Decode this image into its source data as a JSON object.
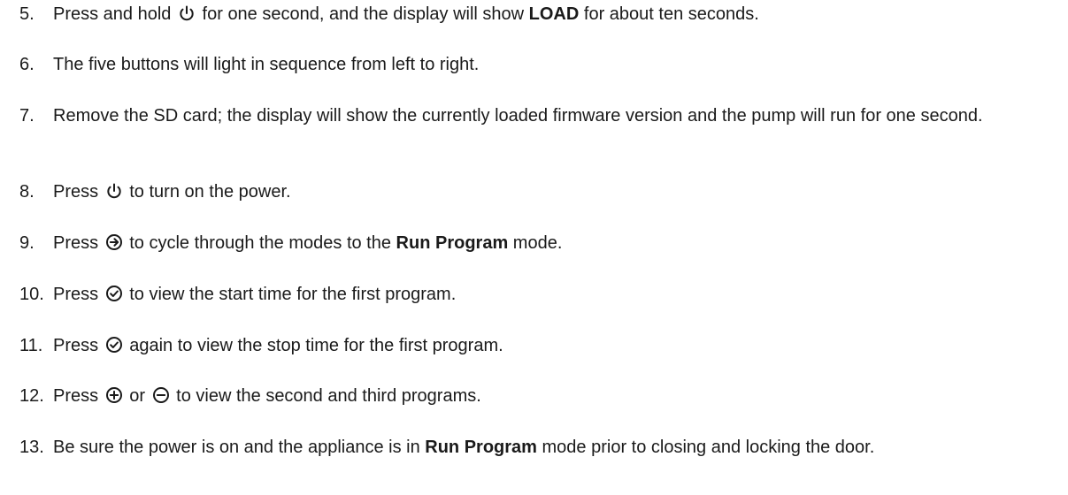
{
  "steps": [
    {
      "number": "5.",
      "parts": [
        {
          "t": "Press and hold "
        },
        {
          "icon": "power-icon"
        },
        {
          "t": " for one second, and the display will show "
        },
        {
          "t": "LOAD",
          "bold": true
        },
        {
          "t": " for about ten seconds."
        }
      ]
    },
    {
      "number": "6.",
      "parts": [
        {
          "t": "The five buttons will light in sequence from left to right."
        }
      ]
    },
    {
      "number": "7.",
      "parts": [
        {
          "t": "Remove the SD card; the display will show the currently loaded firmware version and the pump will run for one second."
        }
      ]
    },
    {
      "number": "8.",
      "parts": [
        {
          "t": "Press "
        },
        {
          "icon": "power-icon"
        },
        {
          "t": " to turn on the power."
        }
      ]
    },
    {
      "number": "9.",
      "parts": [
        {
          "t": "Press "
        },
        {
          "icon": "arrow-circle-right-icon"
        },
        {
          "t": " to cycle through the modes to the "
        },
        {
          "t": "Run Program",
          "bold": true
        },
        {
          "t": " mode."
        }
      ]
    },
    {
      "number": "10.",
      "parts": [
        {
          "t": "Press "
        },
        {
          "icon": "check-circle-icon"
        },
        {
          "t": " to view the start time for the first program."
        }
      ]
    },
    {
      "number": "11.",
      "parts": [
        {
          "t": "Press "
        },
        {
          "icon": "check-circle-icon"
        },
        {
          "t": " again to view the stop time for the first program."
        }
      ]
    },
    {
      "number": "12.",
      "parts": [
        {
          "t": "Press "
        },
        {
          "icon": "plus-circle-icon"
        },
        {
          "t": " or "
        },
        {
          "icon": "minus-circle-icon"
        },
        {
          "t": " to view the second and third programs."
        }
      ]
    },
    {
      "number": "13.",
      "parts": [
        {
          "t": "Be sure the power is on and the appliance is in "
        },
        {
          "t": "Run Program",
          "bold": true
        },
        {
          "t": " mode prior to closing and locking the door."
        }
      ]
    }
  ]
}
